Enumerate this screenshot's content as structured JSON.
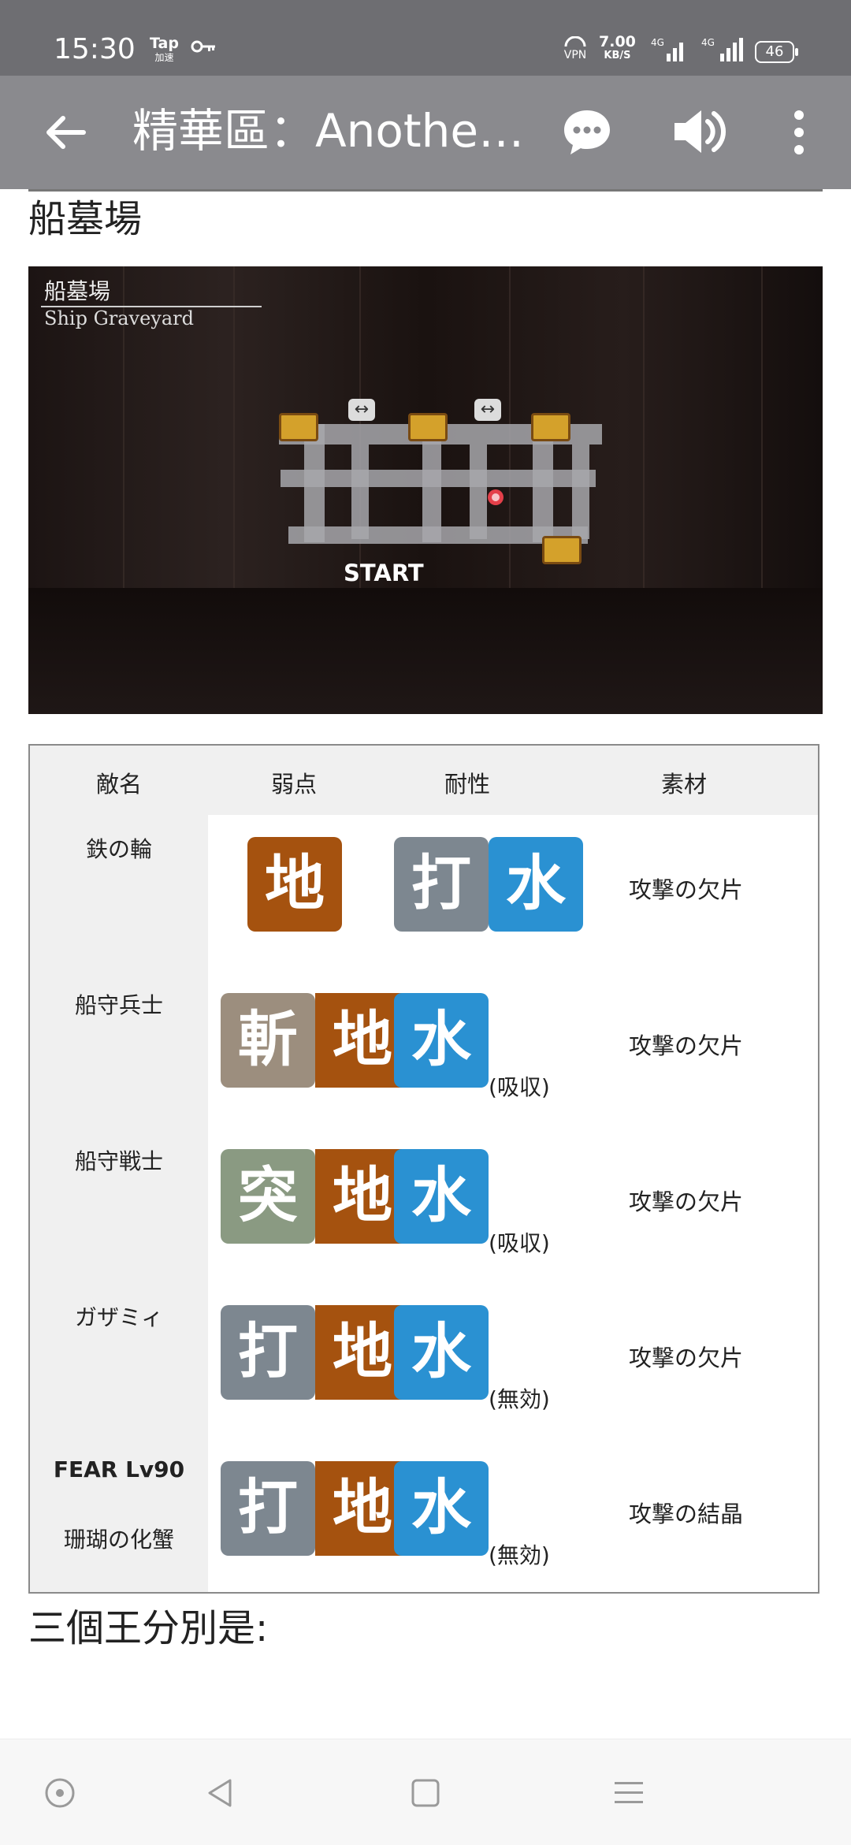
{
  "status_bar": {
    "time": "15:30",
    "tap_label": "Tap",
    "tap_sub": "加速",
    "key_icon": "key-icon",
    "vpn_label": "VPN",
    "speed_value": "7.00",
    "speed_unit": "KB/S",
    "network1": "4G",
    "network2": "4G",
    "battery": "46"
  },
  "app_bar": {
    "title": "精華區：Another Eden",
    "back_icon": "arrow-left-icon",
    "chat_icon": "chat-bubble-icon",
    "sound_icon": "speaker-icon",
    "more_icon": "more-vertical-icon"
  },
  "section": {
    "title": "船墓場"
  },
  "map": {
    "name_jp": "船墓場",
    "name_en": "Ship Graveyard",
    "start_label": "START"
  },
  "table": {
    "headers": [
      "敵名",
      "弱点",
      "耐性",
      "素材"
    ],
    "rows": [
      {
        "name_lines": [
          "鉄の輪"
        ],
        "weakness": [
          {
            "char": "地",
            "color": "#a5520f"
          }
        ],
        "resistance": [
          {
            "char": "打",
            "color": "#7d8790"
          },
          {
            "char": "水",
            "color": "#2a91d2"
          }
        ],
        "note": "",
        "material": "攻撃の欠片"
      },
      {
        "name_lines": [
          "船守兵士"
        ],
        "weakness": [],
        "resistance": [
          {
            "char": "斬",
            "color": "#9c8e7e"
          },
          {
            "char": "地",
            "color": "#a5520f"
          },
          {
            "char": "水",
            "color": "#2a91d2"
          }
        ],
        "note": "(吸収)",
        "material": "攻撃の欠片"
      },
      {
        "name_lines": [
          "船守戦士"
        ],
        "weakness": [],
        "resistance": [
          {
            "char": "突",
            "color": "#8a9a82"
          },
          {
            "char": "地",
            "color": "#a5520f"
          },
          {
            "char": "水",
            "color": "#2a91d2"
          }
        ],
        "note": "(吸収)",
        "material": "攻撃の欠片"
      },
      {
        "name_lines": [
          "ガザミィ"
        ],
        "weakness": [],
        "resistance": [
          {
            "char": "打",
            "color": "#7d8790"
          },
          {
            "char": "地",
            "color": "#a5520f"
          },
          {
            "char": "水",
            "color": "#2a91d2"
          }
        ],
        "note": "(無効)",
        "material": "攻撃の欠片"
      },
      {
        "name_lines": [
          "FEAR Lv90",
          "珊瑚の化蟹"
        ],
        "weakness": [],
        "resistance": [
          {
            "char": "打",
            "color": "#7d8790"
          },
          {
            "char": "地",
            "color": "#a5520f"
          },
          {
            "char": "水",
            "color": "#2a91d2"
          }
        ],
        "note": "(無効)",
        "material": "攻撃の結晶"
      }
    ]
  },
  "footer_text": "三個王分別是:",
  "nav_bar": {
    "items": [
      "circle-dot-icon",
      "triangle-back-icon",
      "square-home-icon",
      "menu-lines-icon"
    ]
  }
}
